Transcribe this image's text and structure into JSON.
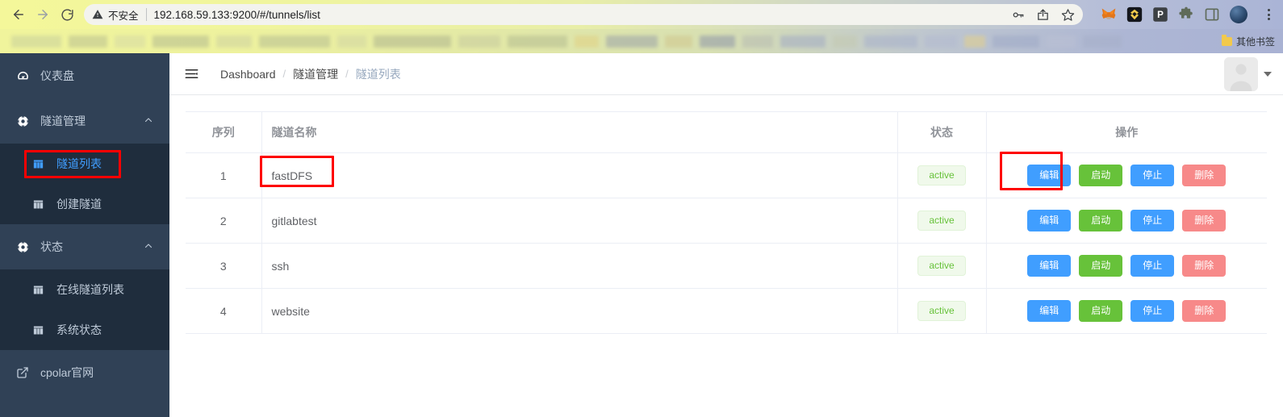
{
  "browser": {
    "back_icon": "back-arrow-icon",
    "forward_icon": "forward-arrow-icon",
    "reload_icon": "reload-icon",
    "security_label": "不安全",
    "url": "192.168.59.133:9200/#/tunnels/list",
    "omnibox_icons": [
      "password-key-icon",
      "share-icon",
      "bookmark-star-icon"
    ],
    "extensions": [
      "metamask-fox-icon",
      "bitkeep-wallet-icon",
      "pocket-p-icon",
      "extensions-puzzle-icon",
      "side-panel-icon"
    ],
    "profile_icon": "profile-avatar-icon",
    "menu_icon": "three-dot-menu-icon",
    "bookmarks": {
      "other_bookmarks_label": "其他书签",
      "folder_icon": "folder-icon"
    }
  },
  "sidebar": {
    "items": [
      {
        "label": "仪表盘",
        "icon": "dashboard-gauge-icon",
        "type": "item"
      },
      {
        "label": "隧道管理",
        "icon": "tunnel-node-icon",
        "type": "group",
        "chevron": "chevron-up-icon"
      },
      {
        "label": "隧道列表",
        "icon": "grid-table-icon",
        "type": "sub",
        "active": true
      },
      {
        "label": "创建隧道",
        "icon": "grid-table-icon",
        "type": "sub",
        "active": false
      },
      {
        "label": "状态",
        "icon": "status-node-icon",
        "type": "group",
        "chevron": "chevron-up-icon"
      },
      {
        "label": "在线隧道列表",
        "icon": "grid-table-icon",
        "type": "sub",
        "active": false
      },
      {
        "label": "系统状态",
        "icon": "grid-table-icon",
        "type": "sub",
        "active": false
      },
      {
        "label": "cpolar官网",
        "icon": "external-link-icon",
        "type": "link"
      }
    ]
  },
  "navbar": {
    "hamburger_icon": "collapse-menu-icon",
    "breadcrumb": [
      {
        "label": "Dashboard",
        "muted": false
      },
      {
        "label": "隧道管理",
        "muted": false
      },
      {
        "label": "隧道列表",
        "muted": true
      }
    ],
    "separator": "/",
    "avatar_icon": "user-avatar-icon",
    "caret_icon": "caret-down-icon"
  },
  "table": {
    "columns": [
      "序列",
      "隧道名称",
      "状态",
      "操作"
    ],
    "rows": [
      {
        "seq": "1",
        "name": "fastDFS",
        "status": "active"
      },
      {
        "seq": "2",
        "name": "gitlabtest",
        "status": "active"
      },
      {
        "seq": "3",
        "name": "ssh",
        "status": "active"
      },
      {
        "seq": "4",
        "name": "website",
        "status": "active"
      }
    ],
    "buttons": {
      "edit": "编辑",
      "start": "启动",
      "stop": "停止",
      "delete": "删除"
    }
  },
  "annotations": {
    "color": "#fe0000",
    "targets": [
      "sidebar-item-tunnel-list",
      "row-1-tunnel-name",
      "row-1-edit-button"
    ]
  },
  "colors": {
    "accent_blue": "#409eff",
    "success_green": "#67c23a",
    "danger_red": "#f78989",
    "sidebar_bg": "#304156",
    "submenu_bg": "#1f2d3d",
    "annotation_red": "#fe0000"
  }
}
